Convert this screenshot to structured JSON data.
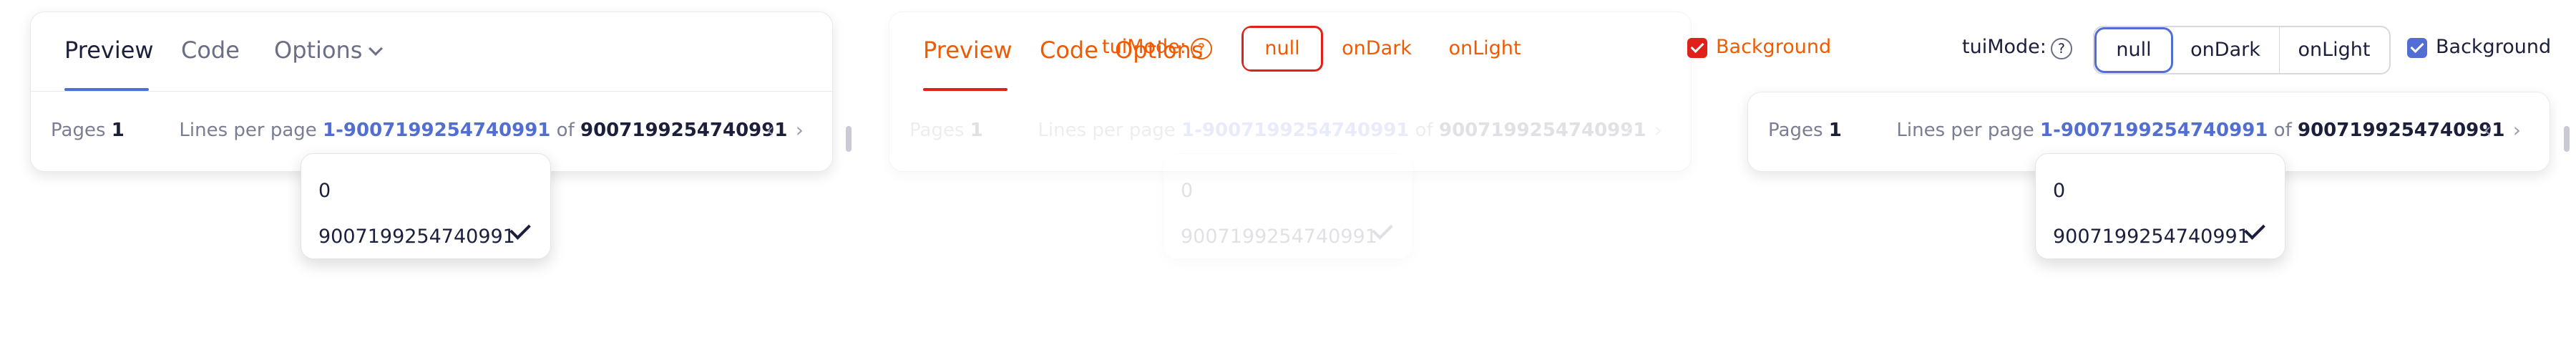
{
  "tabs": {
    "preview": "Preview",
    "code": "Code",
    "options": "Options"
  },
  "pager": {
    "pages_label": "Pages",
    "pages_value": "1",
    "lines_label": "Lines per page",
    "range": "1-9007199254740991",
    "of": "of",
    "total": "9007199254740991"
  },
  "dropdown": {
    "options": [
      "0",
      "9007199254740991"
    ],
    "selected_index": 1
  },
  "toolbar": {
    "mode_label": "tuiMode:",
    "help": "?",
    "modes": [
      "null",
      "onDark",
      "onLight"
    ],
    "selected_mode": "null",
    "background_label": "Background",
    "background_checked": true
  },
  "colors": {
    "accent": "#526ed3",
    "overlay_orange": "#f05a00",
    "overlay_red": "#e0201a"
  }
}
